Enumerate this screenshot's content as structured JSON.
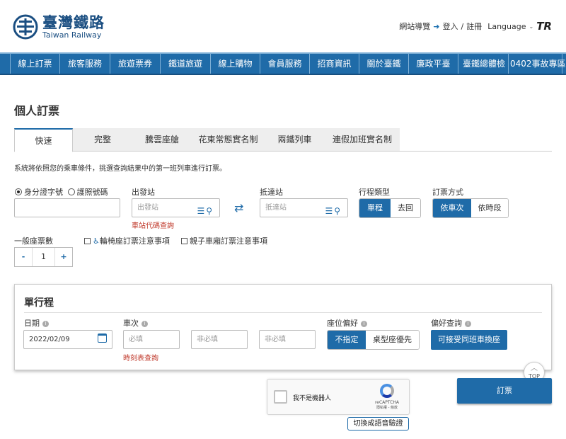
{
  "header": {
    "logo_zh": "臺灣鐵路",
    "logo_en": "Taiwan Railway",
    "sitemap": "網站導覽",
    "login": "登入",
    "sep": "/",
    "register": "註冊",
    "language": "Language",
    "brand_mark": "TR"
  },
  "nav": [
    "線上訂票",
    "旅客服務",
    "旅遊票券",
    "鐵道旅遊",
    "線上購物",
    "會員服務",
    "招商資訊",
    "關於臺鐵",
    "廉政平臺",
    "臺鐵總體檢",
    "0402事故專區"
  ],
  "page_title": "個人訂票",
  "tabs": [
    "快速",
    "完整",
    "騰雲座艙",
    "花東常態實名制",
    "兩鐵列車",
    "連假加班實名制"
  ],
  "description": "系統將依照您的乘車條件，挑選查詢結果中的第一班列車進行訂票。",
  "id_type": {
    "option1": "身分證字號",
    "option2": "護照號碼",
    "selected": "身分證字號"
  },
  "departure": {
    "label": "出發站",
    "placeholder": "出發站",
    "link": "車站代碼查詢"
  },
  "arrival": {
    "label": "抵達站",
    "placeholder": "抵達站"
  },
  "trip_type": {
    "label": "行程類型",
    "options": [
      "單程",
      "去回"
    ],
    "selected": "單程"
  },
  "booking_method": {
    "label": "訂票方式",
    "options": [
      "依車次",
      "依時段"
    ],
    "selected": "依車次"
  },
  "tickets": {
    "label": "一般座票數",
    "minus": "-",
    "value": "1",
    "plus": "+"
  },
  "checkboxes": {
    "wheelchair": "輪椅座訂票注意事項",
    "family": "親子車廂訂票注意事項"
  },
  "panel": {
    "title": "單行程",
    "date_label": "日期",
    "date_value": "2022/02/09",
    "train_label": "車次",
    "train_placeholders": [
      "必填",
      "非必填",
      "非必填"
    ],
    "timetable_link": "時刻表查詢",
    "seat_pref_label": "座位偏好",
    "seat_pref_options": [
      "不指定",
      "桌型座優先"
    ],
    "seat_pref_selected": "不指定",
    "pref_query_label": "偏好查詢",
    "pref_query_button": "可接受同班車換座"
  },
  "top_button": "TOP",
  "captcha": {
    "text": "我不是機器人",
    "brand": "reCAPTCHA",
    "terms": "隱私權 - 條款",
    "audio": "切換成語音驗證"
  },
  "submit": "訂票",
  "colors": {
    "primary": "#1f6ba8",
    "link_red": "#c0392b"
  }
}
